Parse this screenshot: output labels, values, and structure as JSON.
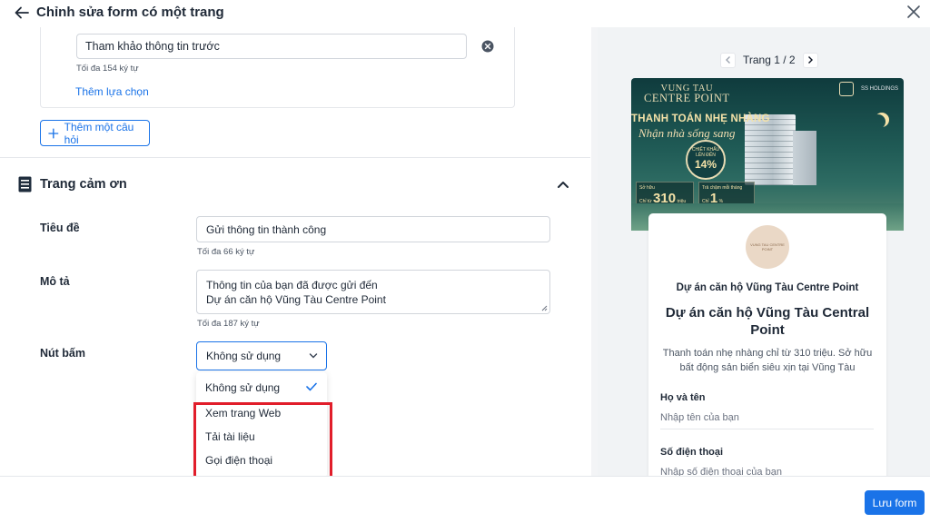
{
  "header": {
    "title": "Chỉnh sửa form có một trang",
    "back_icon": "arrow-left-icon",
    "close_icon": "close-icon"
  },
  "editor": {
    "choice": {
      "value": "Tham khảo thông tin trước",
      "hint": "Tối đa 154 ký tự",
      "add_choice_label": "Thêm lựa chọn"
    },
    "add_question_label": "Thêm một câu hỏi",
    "thank_you_section": {
      "title": "Trang cảm ơn",
      "fields": {
        "title_label": "Tiêu đề",
        "title_value": "Gửi thông tin thành công",
        "title_hint": "Tối đa 66 ký tự",
        "description_label": "Mô tả",
        "description_line1": "Thông tin của bạn đã được gửi đến",
        "description_line2": "Dự án căn hộ Vũng Tàu Centre Point",
        "description_hint": "Tối đa 187 ký tự",
        "button_label": "Nút bấm",
        "button_value": "Không sử dụng"
      },
      "dropdown_options": [
        {
          "label": "Không sử dụng",
          "selected": true
        },
        {
          "label": "Xem trang Web",
          "selected": false
        },
        {
          "label": "Tải tài liệu",
          "selected": false
        },
        {
          "label": "Gọi điện thoại",
          "selected": false
        }
      ]
    }
  },
  "preview": {
    "pager": {
      "text": "Trang 1 / 2"
    },
    "banner": {
      "brand_line1": "VUNG TAU",
      "brand_line2": "CENTRE POINT",
      "logo_text": "SS HOLDINGS",
      "headline": "THANH TOÁN NHẸ NHÀNG",
      "script": "Nhận nhà sống sang",
      "badge_top": "CHIẾT KHẤU LÊN ĐẾN",
      "badge_value": "14%",
      "price_left_label": "Sở hữu",
      "price_left_prefix": "Chỉ từ",
      "price_left_value": "310",
      "price_left_unit": "triệu",
      "price_right_label": "Trả chậm mỗi tháng",
      "price_right_prefix": "Chỉ",
      "price_right_value": "1",
      "price_right_unit": "%"
    },
    "form": {
      "logo_text": "VUNG TAU CENTRE POINT",
      "subtitle": "Dự án căn hộ Vũng Tàu Centre Point",
      "heading": "Dự án căn hộ Vũng Tàu Central Point",
      "description": "Thanh toán nhẹ nhàng chỉ từ 310 triệu. Sở hữu bất động sản biển siêu xịn tại Vũng Tàu",
      "name_label": "Họ và tên",
      "name_placeholder": "Nhập tên của bạn",
      "phone_label": "Số điện thoại",
      "phone_placeholder": "Nhập số điện thoại của bạn"
    }
  },
  "footer": {
    "save_label": "Lưu form"
  },
  "colors": {
    "accent": "#1a73e8",
    "highlight": "#e11d2a",
    "preview_bg": "#f1f3f5"
  }
}
